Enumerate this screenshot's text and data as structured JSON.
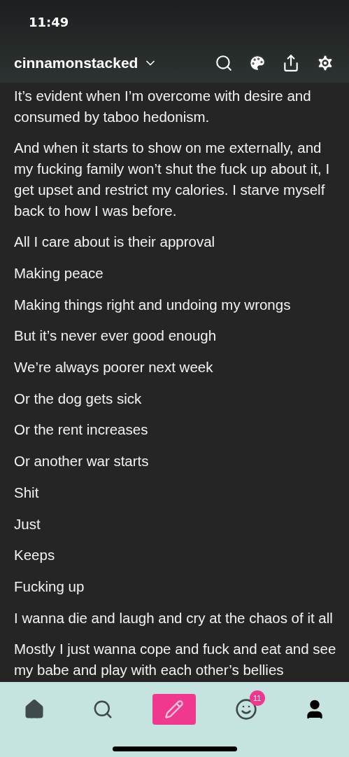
{
  "status_bar": {
    "time": "11:49"
  },
  "header": {
    "blog_name": "cinnamonstacked"
  },
  "post": {
    "paragraphs": [
      "It’s evident when I’m overcome with desire and consumed by taboo hedonism.",
      "And when it starts to show on me externally, and my fucking family won’t shut the fuck up about it, I get upset and restrict my calories. I starve myself back to how I was before.",
      "All I care about is their approval",
      "Making peace",
      "Making things right and undoing my wrongs",
      "But it’s never ever good enough",
      "We’re always poorer next week",
      "Or the dog gets sick",
      "Or the rent increases",
      "Or another war starts",
      "Shit",
      "Just",
      "Keeps",
      "Fucking up",
      "I wanna die and laugh and cry at the chaos of it all",
      "Mostly I just wanna cope and fuck and eat and see my babe and play with each other’s bellies"
    ]
  },
  "tab_bar": {
    "items": [
      {
        "kind": "home"
      },
      {
        "kind": "search"
      },
      {
        "kind": "compose"
      },
      {
        "kind": "activity",
        "badge": "11"
      },
      {
        "kind": "account"
      }
    ]
  }
}
